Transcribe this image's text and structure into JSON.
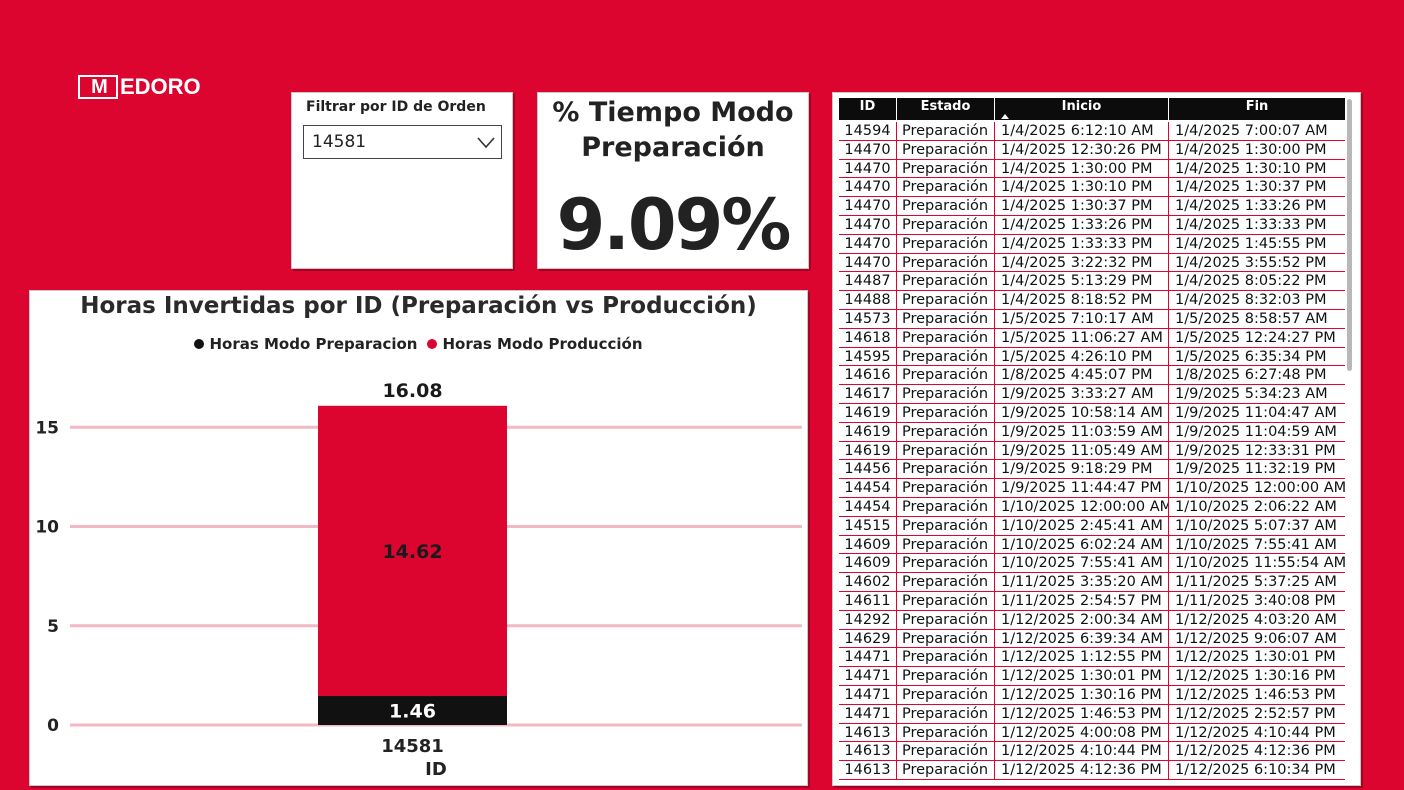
{
  "brand": {
    "mark": "M",
    "name": "EDORO"
  },
  "slicer": {
    "title": "Filtrar por ID de Orden",
    "value": "14581"
  },
  "kpi": {
    "title_line1": "% Tiempo Modo",
    "title_line2": "Preparación",
    "value": "9.09%"
  },
  "chart": {
    "title": "Horas Invertidas por ID (Preparación vs Producción)",
    "legend": [
      {
        "label": "Horas Modo Preparacion",
        "color": "#111111"
      },
      {
        "label": "Horas Modo Producción",
        "color": "#dc0530"
      }
    ],
    "total_label": "16.08",
    "xlabel": "ID"
  },
  "chart_data": {
    "type": "bar",
    "stacked": true,
    "categories": [
      "14581"
    ],
    "series": [
      {
        "name": "Horas Modo Preparacion",
        "values": [
          1.46
        ],
        "color": "#111111"
      },
      {
        "name": "Horas Modo Producción",
        "values": [
          14.62
        ],
        "color": "#dc0530"
      }
    ],
    "totals": [
      16.08
    ],
    "xlabel": "ID",
    "ylabel": "",
    "ylim": [
      0,
      16.5
    ],
    "yticks": [
      0,
      5,
      10,
      15
    ],
    "grid": true,
    "legend_position": "top-center"
  },
  "table": {
    "columns": [
      "ID",
      "Estado",
      "Inicio",
      "Fin"
    ],
    "rows": [
      [
        "14594",
        "Preparación",
        "1/4/2025 6:12:10 AM",
        "1/4/2025 7:00:07 AM"
      ],
      [
        "14470",
        "Preparación",
        "1/4/2025 12:30:26 PM",
        "1/4/2025 1:30:00 PM"
      ],
      [
        "14470",
        "Preparación",
        "1/4/2025 1:30:00 PM",
        "1/4/2025 1:30:10 PM"
      ],
      [
        "14470",
        "Preparación",
        "1/4/2025 1:30:10 PM",
        "1/4/2025 1:30:37 PM"
      ],
      [
        "14470",
        "Preparación",
        "1/4/2025 1:30:37 PM",
        "1/4/2025 1:33:26 PM"
      ],
      [
        "14470",
        "Preparación",
        "1/4/2025 1:33:26 PM",
        "1/4/2025 1:33:33 PM"
      ],
      [
        "14470",
        "Preparación",
        "1/4/2025 1:33:33 PM",
        "1/4/2025 1:45:55 PM"
      ],
      [
        "14470",
        "Preparación",
        "1/4/2025 3:22:32 PM",
        "1/4/2025 3:55:52 PM"
      ],
      [
        "14487",
        "Preparación",
        "1/4/2025 5:13:29 PM",
        "1/4/2025 8:05:22 PM"
      ],
      [
        "14488",
        "Preparación",
        "1/4/2025 8:18:52 PM",
        "1/4/2025 8:32:03 PM"
      ],
      [
        "14573",
        "Preparación",
        "1/5/2025 7:10:17 AM",
        "1/5/2025 8:58:57 AM"
      ],
      [
        "14618",
        "Preparación",
        "1/5/2025 11:06:27 AM",
        "1/5/2025 12:24:27 PM"
      ],
      [
        "14595",
        "Preparación",
        "1/5/2025 4:26:10 PM",
        "1/5/2025 6:35:34 PM"
      ],
      [
        "14616",
        "Preparación",
        "1/8/2025 4:45:07 PM",
        "1/8/2025 6:27:48 PM"
      ],
      [
        "14617",
        "Preparación",
        "1/9/2025 3:33:27 AM",
        "1/9/2025 5:34:23 AM"
      ],
      [
        "14619",
        "Preparación",
        "1/9/2025 10:58:14 AM",
        "1/9/2025 11:04:47 AM"
      ],
      [
        "14619",
        "Preparación",
        "1/9/2025 11:03:59 AM",
        "1/9/2025 11:04:59 AM"
      ],
      [
        "14619",
        "Preparación",
        "1/9/2025 11:05:49 AM",
        "1/9/2025 12:33:31 PM"
      ],
      [
        "14456",
        "Preparación",
        "1/9/2025 9:18:29 PM",
        "1/9/2025 11:32:19 PM"
      ],
      [
        "14454",
        "Preparación",
        "1/9/2025 11:44:47 PM",
        "1/10/2025 12:00:00 AM"
      ],
      [
        "14454",
        "Preparación",
        "1/10/2025 12:00:00 AM",
        "1/10/2025 2:06:22 AM"
      ],
      [
        "14515",
        "Preparación",
        "1/10/2025 2:45:41 AM",
        "1/10/2025 5:07:37 AM"
      ],
      [
        "14609",
        "Preparación",
        "1/10/2025 6:02:24 AM",
        "1/10/2025 7:55:41 AM"
      ],
      [
        "14609",
        "Preparación",
        "1/10/2025 7:55:41 AM",
        "1/10/2025 11:55:54 AM"
      ],
      [
        "14602",
        "Preparación",
        "1/11/2025 3:35:20 AM",
        "1/11/2025 5:37:25 AM"
      ],
      [
        "14611",
        "Preparación",
        "1/11/2025 2:54:57 PM",
        "1/11/2025 3:40:08 PM"
      ],
      [
        "14292",
        "Preparación",
        "1/12/2025 2:00:34 AM",
        "1/12/2025 4:03:20 AM"
      ],
      [
        "14629",
        "Preparación",
        "1/12/2025 6:39:34 AM",
        "1/12/2025 9:06:07 AM"
      ],
      [
        "14471",
        "Preparación",
        "1/12/2025 1:12:55 PM",
        "1/12/2025 1:30:01 PM"
      ],
      [
        "14471",
        "Preparación",
        "1/12/2025 1:30:01 PM",
        "1/12/2025 1:30:16 PM"
      ],
      [
        "14471",
        "Preparación",
        "1/12/2025 1:30:16 PM",
        "1/12/2025 1:46:53 PM"
      ],
      [
        "14471",
        "Preparación",
        "1/12/2025 1:46:53 PM",
        "1/12/2025 2:52:57 PM"
      ],
      [
        "14613",
        "Preparación",
        "1/12/2025 4:00:08 PM",
        "1/12/2025 4:10:44 PM"
      ],
      [
        "14613",
        "Preparación",
        "1/12/2025 4:10:44 PM",
        "1/12/2025 4:12:36 PM"
      ],
      [
        "14613",
        "Preparación",
        "1/12/2025 4:12:36 PM",
        "1/12/2025 6:10:34 PM"
      ]
    ]
  }
}
